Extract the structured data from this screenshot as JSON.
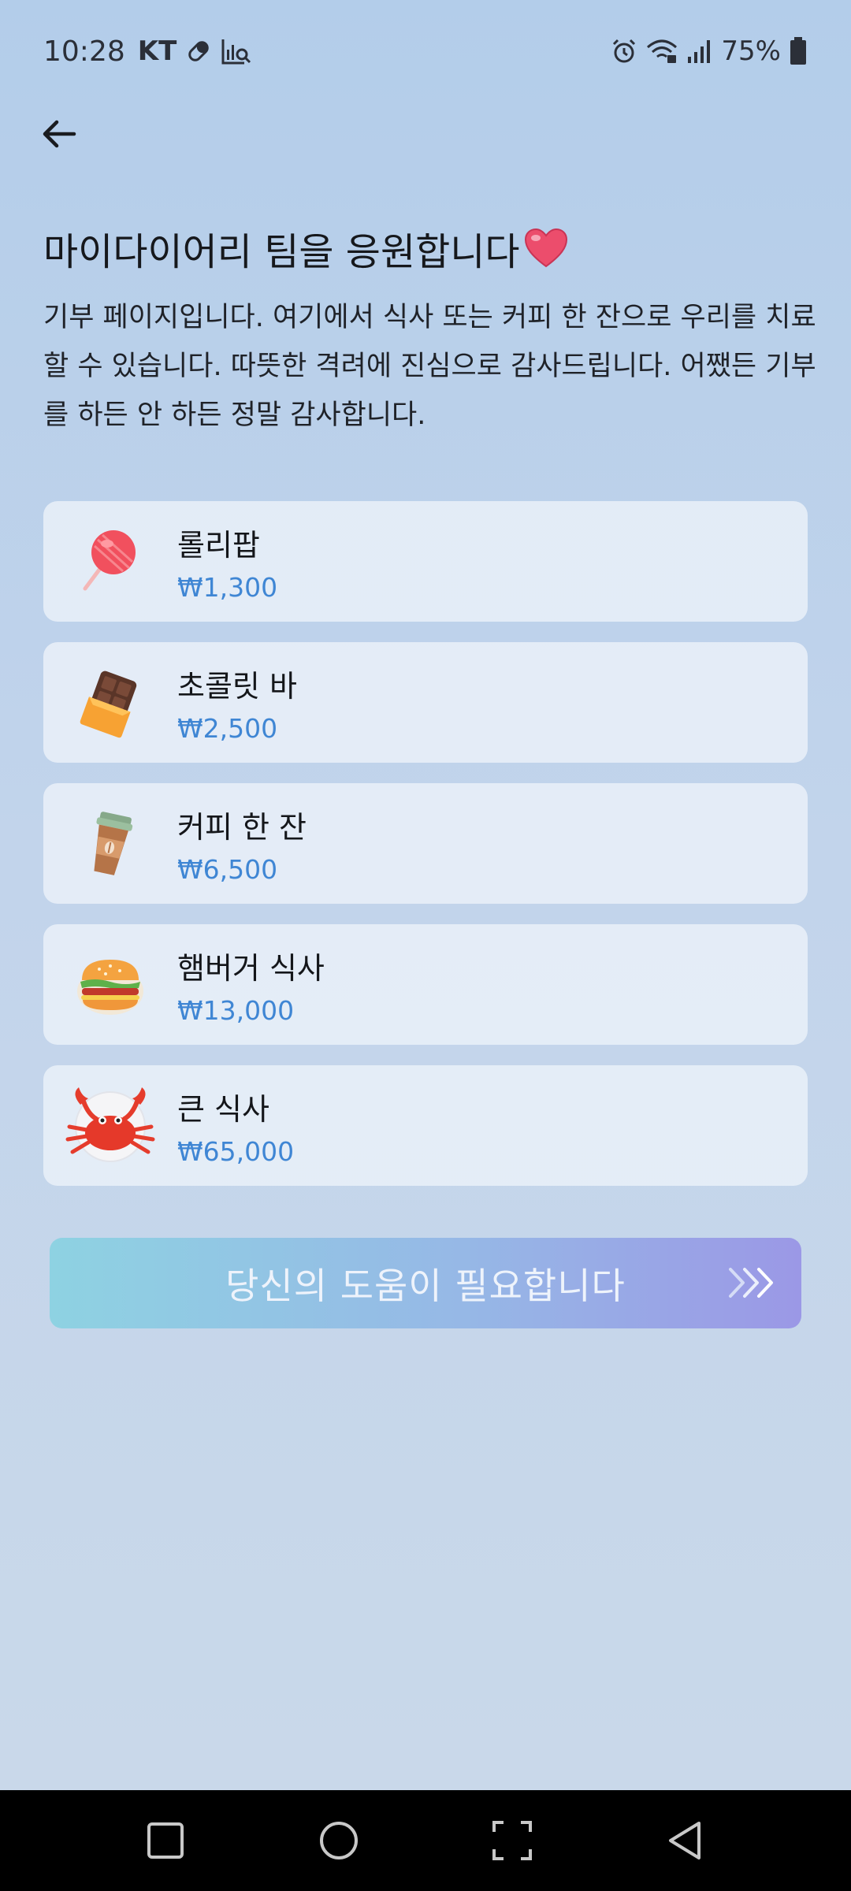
{
  "status_bar": {
    "time": "10:28",
    "carrier": "KT",
    "battery": "75%"
  },
  "page": {
    "title": "마이다이어리 팀을 응원합니다",
    "description": "기부 페이지입니다. 여기에서 식사 또는 커피 한 잔으로 우리를 치료할 수 있습니다. 따뜻한 격려에 진심으로 감사드립니다. 어쨌든 기부를 하든 안 하든 정말 감사합니다."
  },
  "items": [
    {
      "name": "롤리팝",
      "price": "₩1,300",
      "icon": "lollipop-icon"
    },
    {
      "name": "초콜릿 바",
      "price": "₩2,500",
      "icon": "chocolate-bar-icon"
    },
    {
      "name": "커피 한 잔",
      "price": "₩6,500",
      "icon": "coffee-cup-icon"
    },
    {
      "name": "햄버거 식사",
      "price": "₩13,000",
      "icon": "hamburger-icon"
    },
    {
      "name": "큰 식사",
      "price": "₩65,000",
      "icon": "crab-icon"
    }
  ],
  "cta": {
    "label": "당신의 도움이 필요합니다"
  },
  "colors": {
    "price": "#3f86d4",
    "heart": "#ec4d6c",
    "cta_start": "#8ed2e2",
    "cta_end": "#9b98e6"
  }
}
